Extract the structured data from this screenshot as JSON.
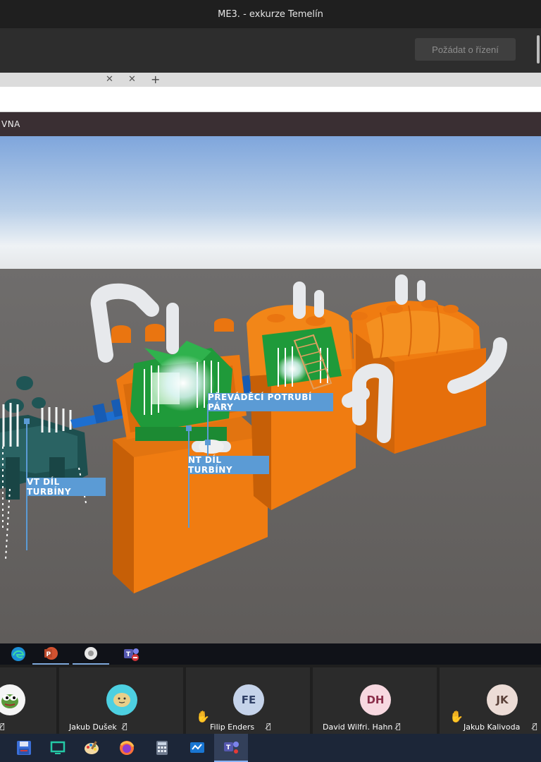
{
  "window": {
    "title": "ME3. - exkurze Temelín"
  },
  "meeting": {
    "request_control_label": "Požádat o řízení"
  },
  "shared_app": {
    "header_text": "VNA"
  },
  "scene_labels": {
    "vt": "VT DÍL TURBÍNY",
    "nt": "NT DÍL TURBÍNY",
    "prevadeci": "PŘEVÁDĚCÍ POTRUBÍ PÁRY"
  },
  "participants": [
    {
      "name": "",
      "initials": "",
      "avatar_color": "#f5f5f5",
      "muted": true,
      "hand_raised": false
    },
    {
      "name": "Jakub Dušek",
      "initials": "",
      "avatar_color": "#4dd0e1",
      "muted": true,
      "hand_raised": false
    },
    {
      "name": "Filip Enders",
      "initials": "FE",
      "avatar_color": "#c5d3ea",
      "muted": true,
      "hand_raised": true
    },
    {
      "name": "David Wilfri. Hahn",
      "initials": "DH",
      "avatar_color": "#f7d8e0",
      "muted": true,
      "hand_raised": false
    },
    {
      "name": "Jakub Kalivoda",
      "initials": "JK",
      "avatar_color": "#ecdcd6",
      "muted": true,
      "hand_raised": true
    }
  ],
  "remote_taskbar": [
    {
      "icon": "edge-icon",
      "active": false
    },
    {
      "icon": "powerpoint-icon",
      "active": true
    },
    {
      "icon": "app-icon",
      "active": true
    },
    {
      "icon": "teams-icon",
      "active": false
    }
  ],
  "taskbar": [
    {
      "icon": "save-icon",
      "active": false
    },
    {
      "icon": "screen-icon",
      "active": false
    },
    {
      "icon": "paint-icon",
      "active": false
    },
    {
      "icon": "firefox-icon",
      "active": false
    },
    {
      "icon": "calculator-icon",
      "active": false
    },
    {
      "icon": "whiteboard-icon",
      "active": false
    },
    {
      "icon": "teams-icon",
      "active": true
    }
  ],
  "colors": {
    "turbine_orange": "#f07c11",
    "rotor_blue": "#1e6fd0",
    "casing_green": "#1f9a3a",
    "label_blue": "#5b9bd5"
  }
}
